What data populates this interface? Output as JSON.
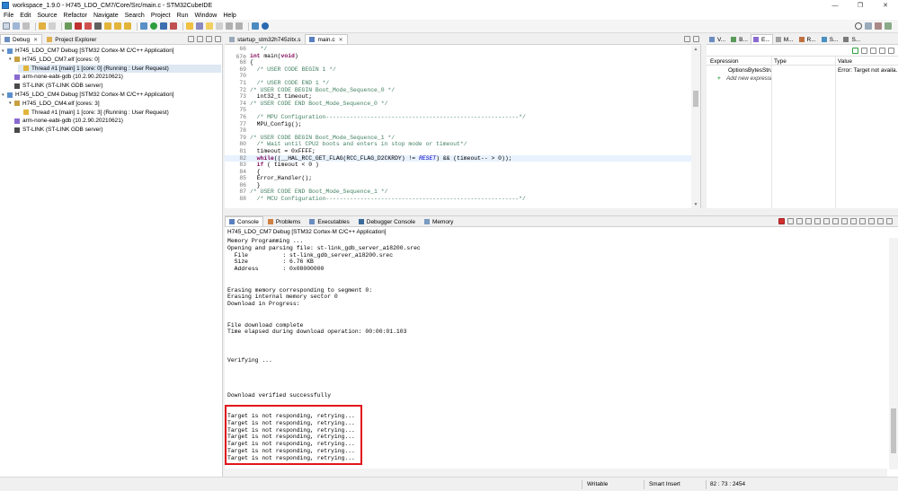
{
  "window": {
    "title": "workspace_1.9.0 - H745_LDO_CM7/Core/Src/main.c - STM32CubeIDE",
    "minimize": "—",
    "maximize": "❐",
    "close": "✕"
  },
  "menu": [
    "File",
    "Edit",
    "Source",
    "Refactor",
    "Navigate",
    "Search",
    "Project",
    "Run",
    "Window",
    "Help"
  ],
  "debug_view": {
    "tabs": [
      {
        "label": "Debug",
        "close": "✕"
      },
      {
        "label": "Project Explorer"
      }
    ],
    "tree": [
      {
        "label": "H745_LDO_CM7 Debug [STM32 Cortex-M C/C++ Application]",
        "caret": "▾",
        "icon": "launch-icon"
      },
      {
        "label": "H745_LDO_CM7.elf [cores: 0]",
        "caret": "▾",
        "icon": "elf-icon"
      },
      {
        "label": "Thread #1 [main] 1 [core: 0] (Running : User Request)",
        "caret": "",
        "icon": "thread-icon"
      },
      {
        "label": "arm-none-eabi-gdb (10.2.90.20210621)",
        "caret": "",
        "icon": "gdb-icon"
      },
      {
        "label": "ST-LINK (ST-LINK GDB server)",
        "caret": "",
        "icon": "stlink-icon"
      },
      {
        "label": "H745_LDO_CM4 Debug [STM32 Cortex-M C/C++ Application]",
        "caret": "▾",
        "icon": "launch-icon"
      },
      {
        "label": "H745_LDO_CM4.elf [cores: 3]",
        "caret": "▾",
        "icon": "elf-icon"
      },
      {
        "label": "Thread #1 [main] 1 [core: 3] (Running : User Request)",
        "caret": "",
        "icon": "thread-icon"
      },
      {
        "label": "arm-none-eabi-gdb (10.2.90.20210621)",
        "caret": "",
        "icon": "gdb-icon"
      },
      {
        "label": "ST-LINK (ST-LINK GDB server)",
        "caret": "",
        "icon": "stlink-icon"
      }
    ]
  },
  "editor": {
    "tabs": [
      {
        "label": "startup_stm32h745zitx.s"
      },
      {
        "label": "main.c",
        "close": "✕"
      }
    ],
    "lines": [
      {
        "n": "66",
        "segs": [
          {
            "t": "   */",
            "c": "cm"
          }
        ]
      },
      {
        "n": "67⊖",
        "segs": [
          {
            "t": "int ",
            "c": "kw"
          },
          {
            "t": "main(",
            "c": ""
          },
          {
            "t": "void",
            "c": "kw"
          },
          {
            "t": ")",
            "c": ""
          }
        ]
      },
      {
        "n": "68",
        "segs": [
          {
            "t": "{",
            "c": ""
          }
        ]
      },
      {
        "n": "69",
        "segs": [
          {
            "t": "  /* USER CODE BEGIN 1 */",
            "c": "cm"
          }
        ]
      },
      {
        "n": "70",
        "segs": [
          {
            "t": "",
            "c": ""
          }
        ]
      },
      {
        "n": "71",
        "segs": [
          {
            "t": "  /* USER CODE END 1 */",
            "c": "cm"
          }
        ]
      },
      {
        "n": "72",
        "segs": [
          {
            "t": "/* USER CODE BEGIN Boot_Mode_Sequence_0 */",
            "c": "cm"
          }
        ]
      },
      {
        "n": "73",
        "segs": [
          {
            "t": "  int32_t timeout;",
            "c": ""
          }
        ]
      },
      {
        "n": "74",
        "segs": [
          {
            "t": "/* USER CODE END Boot_Mode_Sequence_0 */",
            "c": "cm"
          }
        ]
      },
      {
        "n": "75",
        "segs": [
          {
            "t": "",
            "c": ""
          }
        ]
      },
      {
        "n": "76",
        "segs": [
          {
            "t": "  /* MPU Configuration--------------------------------------------------------*/",
            "c": "cm"
          }
        ]
      },
      {
        "n": "77",
        "segs": [
          {
            "t": "  MPU_Config();",
            "c": ""
          }
        ]
      },
      {
        "n": "78",
        "segs": [
          {
            "t": "",
            "c": ""
          }
        ]
      },
      {
        "n": "79",
        "segs": [
          {
            "t": "/* USER CODE BEGIN Boot_Mode_Sequence_1 */",
            "c": "cm"
          }
        ]
      },
      {
        "n": "80",
        "segs": [
          {
            "t": "  /* Wait until CPU2 boots and enters in stop mode or timeout*/",
            "c": "cm"
          }
        ]
      },
      {
        "n": "81",
        "segs": [
          {
            "t": "  timeout = 0xFFFF;",
            "c": ""
          }
        ]
      },
      {
        "n": "82",
        "hl": true,
        "segs": [
          {
            "t": "  ",
            "c": ""
          },
          {
            "t": "while",
            "c": "kw"
          },
          {
            "t": "((__HAL_RCC_GET_FLAG(RCC_FLAG_D2CKRDY) != ",
            "c": ""
          },
          {
            "t": "RESET",
            "c": "mac"
          },
          {
            "t": ") && (timeout-- > 0));",
            "c": ""
          }
        ]
      },
      {
        "n": "83",
        "segs": [
          {
            "t": "  ",
            "c": ""
          },
          {
            "t": "if",
            "c": "kw"
          },
          {
            "t": " ( timeout < 0 )",
            "c": ""
          }
        ]
      },
      {
        "n": "84",
        "segs": [
          {
            "t": "  {",
            "c": ""
          }
        ]
      },
      {
        "n": "85",
        "segs": [
          {
            "t": "  Error_Handler();",
            "c": ""
          }
        ]
      },
      {
        "n": "86",
        "segs": [
          {
            "t": "  }",
            "c": ""
          }
        ]
      },
      {
        "n": "87",
        "segs": [
          {
            "t": "/* USER CODE END Boot_Mode_Sequence_1 */",
            "c": "cm"
          }
        ]
      },
      {
        "n": "88",
        "segs": [
          {
            "t": "  /* MCU Configuration--------------------------------------------------------*/",
            "c": "cm"
          }
        ]
      }
    ]
  },
  "expressions": {
    "tabs": [
      "V...",
      "B...",
      "E...",
      "M...",
      "R...",
      "S...",
      "S..."
    ],
    "columns": [
      "Expression",
      "Type",
      "Value"
    ],
    "rows": [
      {
        "expression": "OptionsBytesStru...",
        "type": "",
        "value": "Error: Target not availa..."
      },
      {
        "expression": "Add new expressi...",
        "type": "",
        "value": ""
      }
    ]
  },
  "console": {
    "tabs": [
      "Console",
      "Problems",
      "Executables",
      "Debugger Console",
      "Memory"
    ],
    "subtitle": "H745_LDO_CM7 Debug [STM32 Cortex-M C/C++ Application]",
    "lines": [
      "Memory Programming ...",
      "Opening and parsing file: st-link_gdb_server_a18200.srec",
      "  File          : st-link_gdb_server_a18200.srec",
      "  Size          : 6.76 KB",
      "  Address       : 0x08000000",
      "",
      "",
      "Erasing memory corresponding to segment 0:",
      "Erasing internal memory sector 0",
      "Download in Progress:",
      "",
      "",
      "File download complete",
      "Time elapsed during download operation: 00:00:01.103",
      "",
      "",
      "",
      "Verifying ...",
      "",
      "",
      "",
      "",
      "Download verified successfully",
      "",
      "",
      "Target is not responding, retrying...",
      "Target is not responding, retrying...",
      "Target is not responding, retrying...",
      "Target is not responding, retrying...",
      "Target is not responding, retrying...",
      "Target is not responding, retrying...",
      "Target is not responding, retrying..."
    ]
  },
  "status": {
    "writable": "Writable",
    "insert_mode": "Smart Insert",
    "position": "82 : 73 : 2454"
  },
  "colors": {
    "highlight_box": "#e0141a",
    "current_line": "#e8f2fe",
    "selection": "#dde8f3"
  }
}
